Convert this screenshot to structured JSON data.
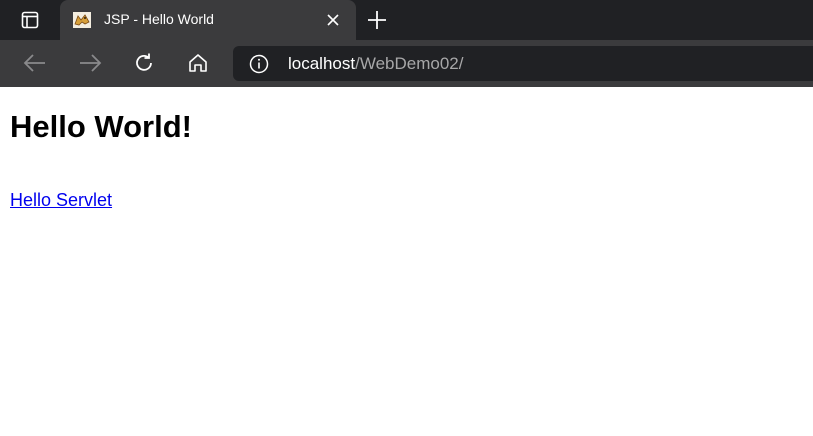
{
  "browser": {
    "tab": {
      "title": "JSP - Hello World",
      "favicon": "tomcat-icon"
    },
    "icons": {
      "tab_actions": "tab-actions-icon",
      "close": "close-icon",
      "new_tab": "plus-icon",
      "back": "back-arrow-icon",
      "forward": "forward-arrow-icon",
      "reload": "reload-icon",
      "home": "home-icon",
      "site_info": "info-icon"
    },
    "address": {
      "host": "localhost",
      "path": "/WebDemo02/"
    },
    "colors": {
      "tabbar_bg": "#202124",
      "toolbar_bg": "#3b3b3d",
      "link": "#0000ee"
    }
  },
  "page": {
    "heading": "Hello World!",
    "link_text": "Hello Servlet"
  }
}
